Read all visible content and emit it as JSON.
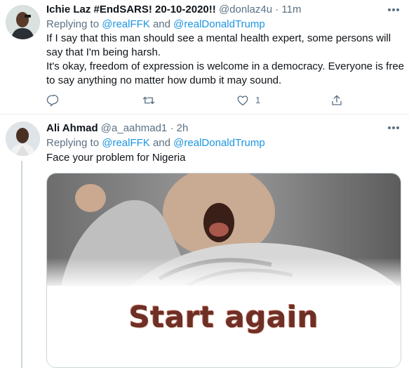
{
  "tweets": [
    {
      "display_name": "Ichie Laz #EndSARS! 20-10-2020!!",
      "handle": "@donlaz4u",
      "separator": "·",
      "time": "11m",
      "replying_prefix": "Replying to",
      "mention_1": "@realFFK",
      "mention_joiner": "and",
      "mention_2": "@realDonaldTrump",
      "text_lines": [
        "If I say that this man should see a mental health expert, some persons will",
        "say that I'm being harsh.",
        "It's okay, freedom of expression is welcome in a democracy. Everyone is free",
        "to say anything no matter how dumb it may sound."
      ],
      "actions": {
        "reply_count": "",
        "retweet_count": "",
        "like_count": "1",
        "icons": [
          "reply-icon",
          "retweet-icon",
          "like-icon",
          "share-icon"
        ]
      }
    },
    {
      "display_name": "Ali Ahmad",
      "handle": "@a_aahmad1",
      "separator": "·",
      "time": "2h",
      "replying_prefix": "Replying to",
      "mention_1": "@realFFK",
      "mention_joiner": "and",
      "mention_2": "@realDonaldTrump",
      "text_lines": [
        "Face your problem for Nigeria"
      ],
      "media": {
        "caption": "Start again",
        "caption_color": "#6e2f24"
      }
    }
  ],
  "colors": {
    "link": "#1b95e0",
    "secondary_text": "#5b7083",
    "divider": "#e6ecf0"
  }
}
